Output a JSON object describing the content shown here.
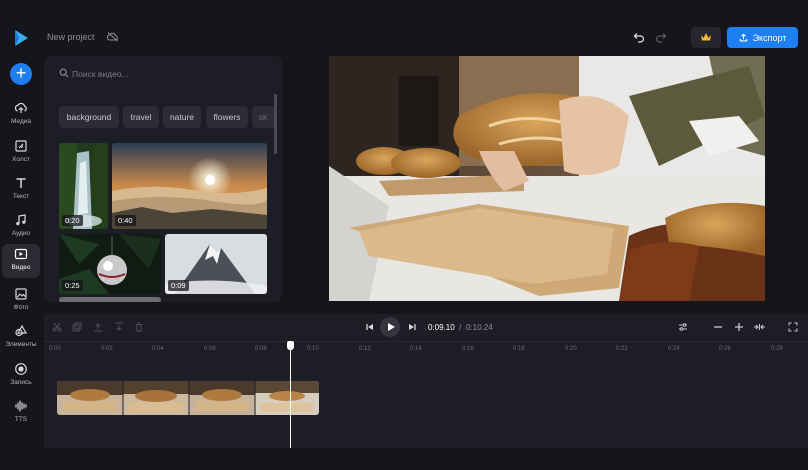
{
  "header": {
    "project_name": "New project",
    "export_label": "Экспорт"
  },
  "sidebar": {
    "items": [
      {
        "label": "Медиа",
        "icon": "upload-icon"
      },
      {
        "label": "Холст",
        "icon": "canvas-icon"
      },
      {
        "label": "Текст",
        "icon": "text-icon"
      },
      {
        "label": "Аудио",
        "icon": "music-icon"
      },
      {
        "label": "Видео",
        "icon": "video-icon",
        "active": true
      },
      {
        "label": "Фото",
        "icon": "photo-icon"
      },
      {
        "label": "Элементы",
        "icon": "shapes-icon"
      },
      {
        "label": "Запись",
        "icon": "record-icon"
      },
      {
        "label": "TTS",
        "icon": "waveform-icon"
      }
    ]
  },
  "media_panel": {
    "search_placeholder": "Поиск видео...",
    "tags": [
      "background",
      "travel",
      "nature",
      "flowers",
      "sk"
    ],
    "videos": [
      {
        "duration": "0:20",
        "subject": "waterfall"
      },
      {
        "duration": "0:40",
        "subject": "sunset-clouds"
      },
      {
        "duration": "0:25",
        "subject": "christmas-ornament"
      },
      {
        "duration": "0:09",
        "subject": "mountain"
      }
    ]
  },
  "timeline": {
    "current_time": "0:09.10",
    "separator": "/",
    "total_time": "0:10.24",
    "ruler_labels": [
      "0:00",
      "0:02",
      "0:04",
      "0:06",
      "0:08",
      "0:10",
      "0:12",
      "0:14",
      "0:16",
      "0:18",
      "0:20",
      "0:22",
      "0:24",
      "0:26",
      "0:28"
    ]
  },
  "colors": {
    "accent": "#1e7ff2",
    "background": "#15151b",
    "panel": "#1d1e25"
  }
}
